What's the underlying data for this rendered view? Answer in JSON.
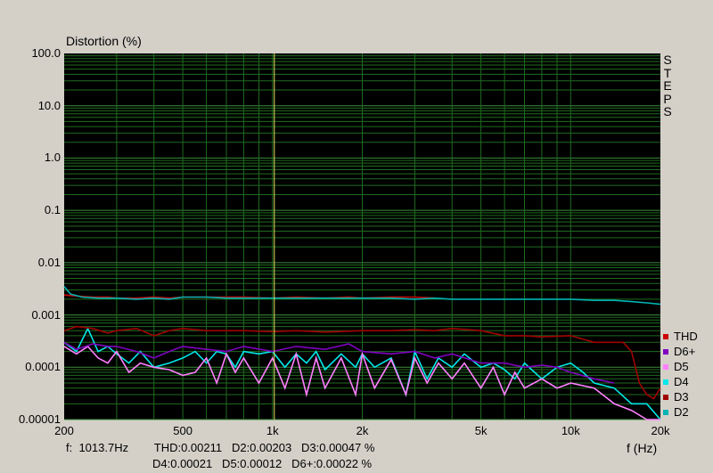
{
  "chart_data": {
    "type": "line",
    "ylabel": "Distortion (%)",
    "xlabel": "f (Hz)",
    "side_label": "STEPS",
    "y_scale": "log",
    "x_scale": "log",
    "ylim": [
      1e-05,
      100
    ],
    "xlim": [
      200,
      20000
    ],
    "grid": true,
    "legend_position": "right-bottom",
    "y_ticks": [
      {
        "value": 100,
        "label": "100.0"
      },
      {
        "value": 10,
        "label": "10.0"
      },
      {
        "value": 1,
        "label": "1.0"
      },
      {
        "value": 0.1,
        "label": "0.1"
      },
      {
        "value": 0.01,
        "label": "0.01"
      },
      {
        "value": 0.001,
        "label": "0.001"
      },
      {
        "value": 0.0001,
        "label": "0.0001"
      },
      {
        "value": 1e-05,
        "label": "0.00001"
      }
    ],
    "x_ticks": [
      {
        "value": 200,
        "label": "200"
      },
      {
        "value": 500,
        "label": "500"
      },
      {
        "value": 1000,
        "label": "1k"
      },
      {
        "value": 2000,
        "label": "2k"
      },
      {
        "value": 5000,
        "label": "5k"
      },
      {
        "value": 10000,
        "label": "10k"
      },
      {
        "value": 20000,
        "label": "20k"
      }
    ],
    "cursor_x": 1013.7,
    "series": [
      {
        "name": "D2",
        "color": "#00b4b4",
        "x": [
          200,
          210,
          230,
          260,
          300,
          350,
          400,
          450,
          500,
          600,
          700,
          800,
          1000,
          1200,
          1500,
          1800,
          2000,
          2500,
          3000,
          3500,
          4000,
          5000,
          6000,
          7000,
          8000,
          9000,
          10000,
          12000,
          14000,
          16000,
          18000,
          20000
        ],
        "y": [
          0.0035,
          0.0025,
          0.0022,
          0.0021,
          0.0021,
          0.002,
          0.0021,
          0.002,
          0.0022,
          0.0022,
          0.0021,
          0.0021,
          0.0021,
          0.0021,
          0.0021,
          0.0021,
          0.0021,
          0.0021,
          0.002,
          0.0021,
          0.002,
          0.002,
          0.002,
          0.002,
          0.002,
          0.002,
          0.002,
          0.0019,
          0.0019,
          0.0018,
          0.0017,
          0.0016
        ]
      },
      {
        "name": "D3",
        "color": "#a00000",
        "x": [
          200,
          220,
          250,
          280,
          300,
          350,
          400,
          450,
          500,
          600,
          700,
          800,
          1000,
          1200,
          1500,
          2000,
          2500,
          3000,
          3500,
          4000,
          5000,
          6000,
          7000,
          8000,
          10000,
          12000,
          14000,
          15000,
          16000,
          17000,
          18000,
          19000,
          20000
        ],
        "y": [
          0.0005,
          0.0006,
          0.00055,
          0.00045,
          0.0005,
          0.00055,
          0.0004,
          0.0005,
          0.00055,
          0.0005,
          0.0005,
          0.0005,
          0.00048,
          0.0005,
          0.00047,
          0.0005,
          0.0005,
          0.00052,
          0.0005,
          0.00055,
          0.0005,
          0.0004,
          0.0004,
          0.00038,
          0.0004,
          0.0003,
          0.0003,
          0.0003,
          0.0002,
          5e-05,
          3e-05,
          2.5e-05,
          4e-05
        ]
      },
      {
        "name": "D4",
        "color": "#00e8e8",
        "x": [
          200,
          220,
          240,
          260,
          280,
          300,
          330,
          360,
          400,
          450,
          500,
          550,
          600,
          650,
          700,
          750,
          800,
          900,
          1000,
          1100,
          1200,
          1300,
          1400,
          1500,
          1700,
          1900,
          2000,
          2200,
          2500,
          2800,
          3000,
          3300,
          3600,
          4000,
          4400,
          5000,
          5500,
          6000,
          6500,
          7000,
          8000,
          9000,
          10000,
          11000,
          12000,
          14000,
          16000,
          18000,
          20000
        ],
        "y": [
          0.0003,
          0.0002,
          0.00055,
          0.0002,
          0.00025,
          0.00018,
          0.00012,
          0.0002,
          0.0001,
          0.00012,
          0.00015,
          0.0002,
          0.00012,
          0.0002,
          0.00018,
          0.0001,
          0.0002,
          0.00018,
          0.0002,
          0.0001,
          0.00018,
          0.00012,
          0.0002,
          9e-05,
          0.00018,
          0.0001,
          0.00018,
          0.0001,
          0.00015,
          3e-05,
          0.0002,
          6e-05,
          0.00015,
          0.0001,
          0.00018,
          0.0001,
          0.00012,
          9e-05,
          6e-05,
          0.00012,
          6e-05,
          0.0001,
          0.00012,
          8e-05,
          5e-05,
          4e-05,
          2e-05,
          2e-05,
          1e-05
        ]
      },
      {
        "name": "D5",
        "color": "#ff80ff",
        "x": [
          200,
          220,
          240,
          260,
          280,
          300,
          330,
          360,
          400,
          450,
          500,
          550,
          600,
          650,
          700,
          750,
          800,
          900,
          1000,
          1100,
          1200,
          1300,
          1400,
          1500,
          1700,
          1900,
          2000,
          2200,
          2500,
          2800,
          3000,
          3300,
          3600,
          4000,
          4400,
          5000,
          5500,
          6000,
          6500,
          7000,
          8000,
          9000,
          10000,
          12000,
          14000,
          16000,
          18000,
          20000
        ],
        "y": [
          0.00025,
          0.00018,
          0.00025,
          0.00015,
          0.00012,
          0.0002,
          8e-05,
          0.00012,
          0.0001,
          9e-05,
          7e-05,
          8e-05,
          0.00015,
          5e-05,
          0.00018,
          8e-05,
          0.00015,
          5e-05,
          0.00015,
          4e-05,
          0.00018,
          3e-05,
          0.00015,
          4e-05,
          0.00015,
          3e-05,
          0.00018,
          4e-05,
          0.00014,
          3e-05,
          0.00015,
          5e-05,
          0.00012,
          6e-05,
          0.00012,
          4e-05,
          0.0001,
          3e-05,
          8e-05,
          4e-05,
          6e-05,
          4e-05,
          5e-05,
          4e-05,
          2e-05,
          1.5e-05,
          1e-05,
          8e-06
        ]
      },
      {
        "name": "D6+",
        "color": "#8000c0",
        "x": [
          200,
          220,
          250,
          280,
          300,
          350,
          400,
          450,
          500,
          600,
          700,
          800,
          1000,
          1200,
          1500,
          1800,
          2000,
          2500,
          3000,
          3500,
          4000,
          5000,
          6000,
          7000,
          8000,
          9000,
          10000,
          12000,
          14000
        ],
        "y": [
          0.0003,
          0.00022,
          0.00028,
          0.00025,
          0.00025,
          0.0002,
          0.00015,
          0.0002,
          0.00025,
          0.00022,
          0.0002,
          0.00025,
          0.0002,
          0.00025,
          0.00022,
          0.00028,
          0.0002,
          0.00018,
          0.0002,
          0.00015,
          0.00018,
          0.00012,
          0.00012,
          0.0001,
          0.00011,
          0.0001,
          8e-05,
          6e-05,
          5e-05
        ]
      },
      {
        "name": "THD",
        "color": "#cc0000",
        "x": [
          200,
          220,
          250,
          280,
          300,
          350,
          400,
          450,
          500,
          600,
          700,
          800,
          1000,
          1200,
          1500,
          1800,
          2000,
          2500,
          3000,
          3500
        ],
        "y": [
          0.0024,
          0.0023,
          0.0022,
          0.0022,
          0.0021,
          0.0021,
          0.0022,
          0.0021,
          0.0022,
          0.0022,
          0.0022,
          0.0022,
          0.0021,
          0.0022,
          0.0021,
          0.0022,
          0.0021,
          0.0022,
          0.0022,
          0.0021
        ]
      }
    ]
  },
  "status": {
    "line1": "f:  1013.7Hz        THD:0.00211   D2:0.00203   D3:0.00047 %",
    "line2": "D4:0.00021   D5:0.00012   D6+:0.00022 %"
  }
}
